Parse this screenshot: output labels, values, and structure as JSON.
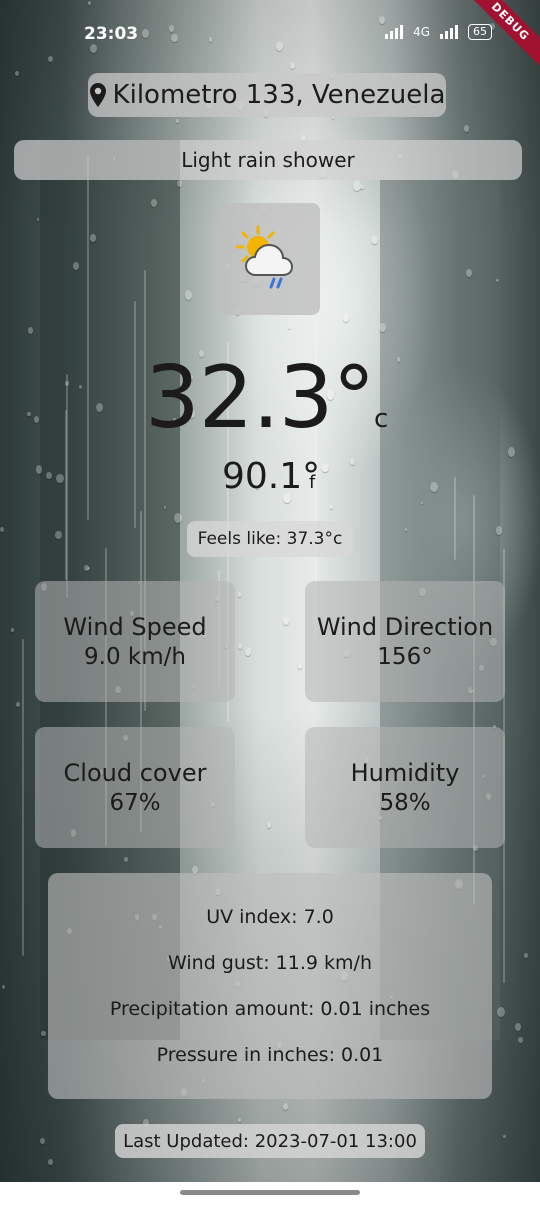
{
  "status_bar": {
    "time": "23:03",
    "network": "4G",
    "battery": "65",
    "debug_label": "DEBUG"
  },
  "location": {
    "icon": "map-pin-icon",
    "name": "Kilometro 133, Venezuela"
  },
  "condition": {
    "text": "Light rain shower",
    "icon": "sun-cloud-rain-icon"
  },
  "temperature": {
    "celsius": "32.3°",
    "celsius_unit": "c",
    "fahrenheit": "90.1°",
    "fahrenheit_unit": "f",
    "feels_like": "Feels like: 37.3°c"
  },
  "cards": [
    {
      "label": "Wind Speed",
      "value": "9.0 km/h"
    },
    {
      "label": "Wind Direction",
      "value": "156°"
    },
    {
      "label": "Cloud cover",
      "value": "67%"
    },
    {
      "label": "Humidity",
      "value": "58%"
    }
  ],
  "details": {
    "uv": "UV index: 7.0",
    "gust": "Wind gust: 11.9 km/h",
    "precip": "Precipitation amount: 0.01 inches",
    "pressure": "Pressure in inches: 0.01"
  },
  "last_updated": "Last Updated: 2023-07-01 13:00",
  "colors": {
    "debug_ribbon": "#a0122f",
    "rain_icon": "#3a74d8",
    "sun_icon": "#f2b400"
  }
}
